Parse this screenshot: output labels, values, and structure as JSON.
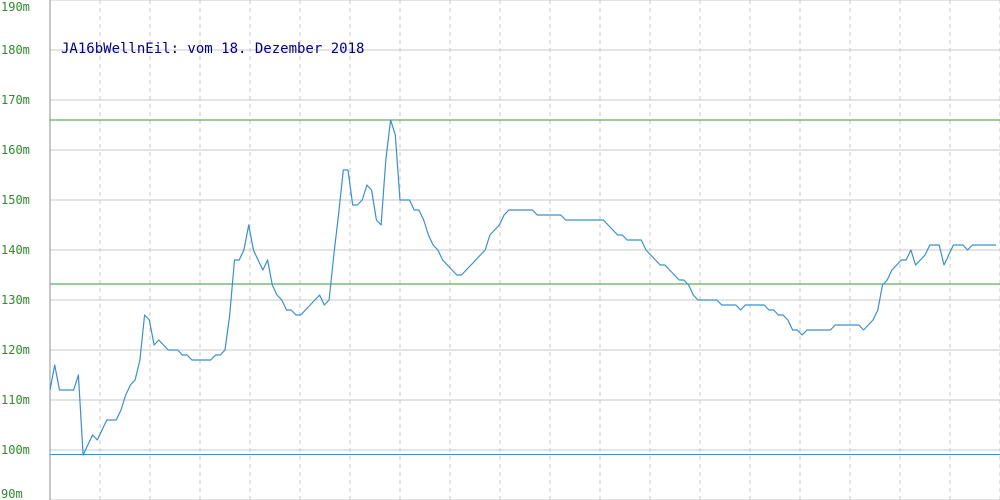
{
  "chart_data": {
    "type": "line",
    "title": "JA16bWellnEil: vom 18. Dezember 2018",
    "xlabel": "",
    "ylabel": "",
    "ylim": [
      90,
      190
    ],
    "yticks": [
      "90m",
      "100m",
      "110m",
      "120m",
      "130m",
      "140m",
      "150m",
      "160m",
      "170m",
      "180m",
      "190m"
    ],
    "grid": true,
    "colors": {
      "series": "#3a8fd0",
      "grid": "#c8c8c8",
      "axis": "#909090",
      "hline_green": "#3a9a3a",
      "hline_blue": "#3a8fd0",
      "tick_text": "#2e8b2e",
      "title_text": "#000080"
    },
    "reference_lines": [
      {
        "y": 166,
        "color": "green"
      },
      {
        "y": 133.2,
        "color": "green"
      },
      {
        "y": 99.1,
        "color": "blue"
      }
    ],
    "series": [
      {
        "x": [
          0,
          1,
          2,
          3,
          4,
          5,
          6,
          7,
          8,
          9,
          10,
          11,
          12,
          13,
          14,
          15,
          16,
          17,
          18,
          19,
          20,
          21,
          22,
          23,
          24,
          25,
          26,
          27,
          28,
          29,
          30,
          31,
          32,
          33,
          34,
          35,
          36,
          37,
          38,
          39,
          40,
          41,
          42,
          43,
          44,
          45,
          46,
          47,
          48,
          49,
          50,
          51,
          52,
          53,
          54,
          55,
          56,
          57,
          58,
          59,
          60,
          61,
          62,
          63,
          64,
          65,
          66,
          67,
          68,
          69,
          70,
          71,
          72,
          73,
          74,
          75,
          76,
          77,
          78,
          79,
          80,
          81,
          82,
          83,
          84,
          85,
          86,
          87,
          88,
          89,
          90,
          91,
          92,
          93,
          94,
          95,
          96,
          97,
          98,
          99,
          100,
          101,
          102,
          103,
          104,
          105,
          106,
          107,
          108,
          109,
          110,
          111,
          112,
          113,
          114,
          115,
          116,
          117,
          118,
          119,
          120,
          121,
          122,
          123,
          124,
          125,
          126,
          127,
          128,
          129,
          130,
          131,
          132,
          133,
          134,
          135,
          136,
          137,
          138,
          139,
          140,
          141,
          142,
          143,
          144,
          145,
          146,
          147,
          148,
          149,
          150,
          151,
          152,
          153,
          154,
          155,
          156,
          157,
          158,
          159,
          160,
          161,
          162,
          163,
          164,
          165,
          166,
          167,
          168,
          169,
          170,
          171,
          172,
          173,
          174,
          175,
          176,
          177,
          178,
          179,
          180,
          181,
          182,
          183,
          184,
          185,
          186,
          187,
          188,
          189,
          190,
          191,
          192,
          193,
          194,
          195,
          196,
          197,
          198,
          199,
          200
        ],
        "values": [
          112,
          117,
          112,
          112,
          112,
          112,
          115,
          99,
          101,
          103,
          102,
          104,
          106,
          106,
          106,
          108,
          111,
          113,
          114,
          118,
          127,
          126,
          121,
          122,
          121,
          120,
          120,
          120,
          119,
          119,
          118,
          118,
          118,
          118,
          118,
          119,
          119,
          120,
          127,
          138,
          138,
          140,
          145,
          140,
          138,
          136,
          138,
          133,
          131,
          130,
          128,
          128,
          127,
          127,
          128,
          129,
          130,
          131,
          129,
          130,
          139,
          147,
          156,
          156,
          149,
          149,
          150,
          153,
          152,
          146,
          145,
          158,
          166,
          163,
          150,
          150,
          150,
          148,
          148,
          146,
          143,
          141,
          140,
          138,
          137,
          136,
          135,
          135,
          136,
          137,
          138,
          139,
          140,
          143,
          144,
          145,
          147,
          148,
          148,
          148,
          148,
          148,
          148,
          147,
          147,
          147,
          147,
          147,
          147,
          146,
          146,
          146,
          146,
          146,
          146,
          146,
          146,
          146,
          145,
          144,
          143,
          143,
          142,
          142,
          142,
          142,
          140,
          139,
          138,
          137,
          137,
          136,
          135,
          134,
          134,
          133,
          131,
          130,
          130,
          130,
          130,
          130,
          129,
          129,
          129,
          129,
          128,
          129,
          129,
          129,
          129,
          129,
          128,
          128,
          127,
          127,
          126,
          124,
          124,
          123,
          124,
          124,
          124,
          124,
          124,
          124,
          125,
          125,
          125,
          125,
          125,
          125,
          124,
          125,
          126,
          128,
          133,
          134,
          136,
          137,
          138,
          138,
          140,
          137,
          138,
          139,
          141,
          141,
          141,
          137,
          139,
          141,
          141,
          141,
          140,
          141,
          141,
          141,
          141,
          141,
          141
        ]
      }
    ]
  }
}
